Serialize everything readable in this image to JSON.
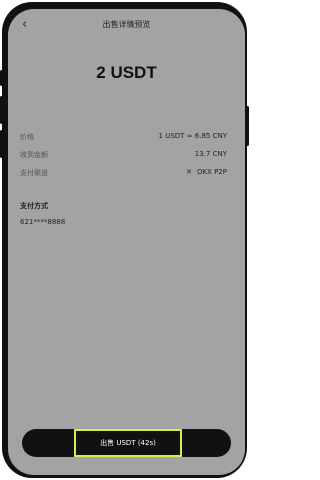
{
  "header": {
    "back_icon": "chevron-left-icon",
    "title": "出售详情预览"
  },
  "amount": "2 USDT",
  "details": [
    {
      "label": "价格",
      "value": "1 USDT ≈ 6.85 CNY"
    },
    {
      "label": "收到金额",
      "value": "13.7 CNY"
    },
    {
      "label": "支付渠道",
      "value": "OKX P2P",
      "icon": "okx-logo-icon"
    }
  ],
  "payment": {
    "title": "支付方式",
    "value": "621****8888"
  },
  "footer": {
    "sell_button": "出售 USDT (42s)"
  },
  "colors": {
    "overlay": "#a3a3a3",
    "highlight": "#c9f24b",
    "button": "#111111"
  }
}
